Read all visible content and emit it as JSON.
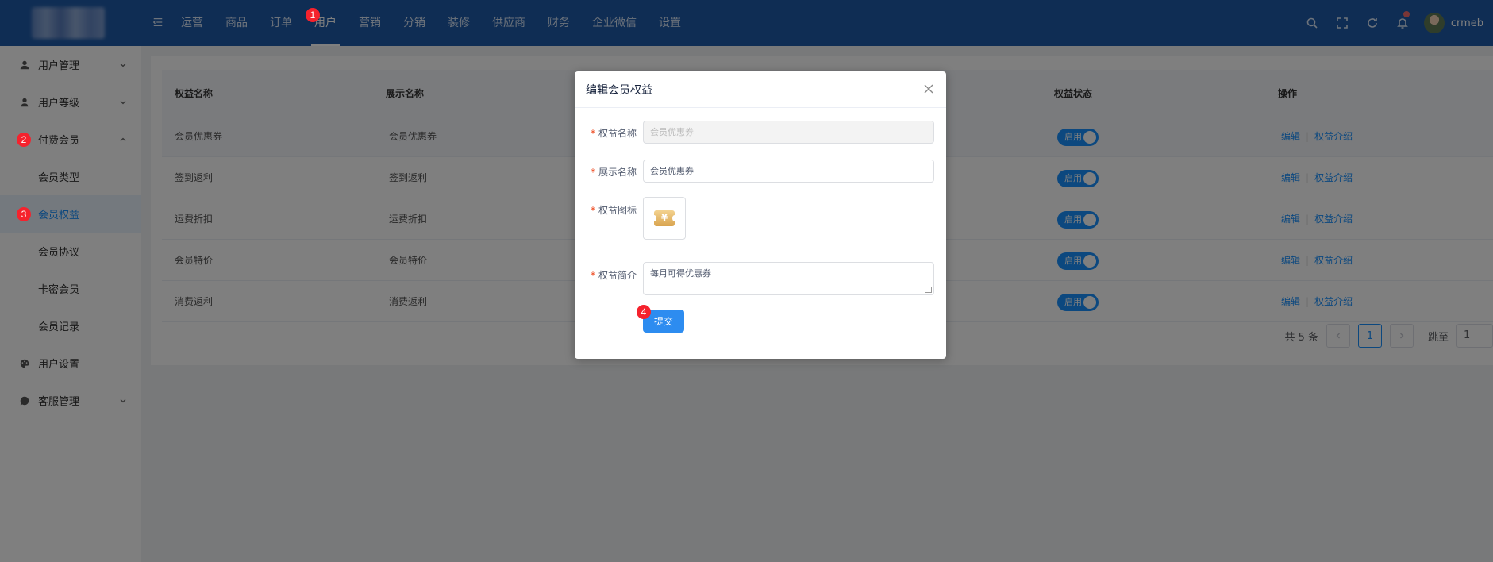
{
  "header": {
    "menu_toggle_icon": "menu-fold-icon",
    "nav": [
      "运营",
      "商品",
      "订单",
      "用户",
      "营销",
      "分销",
      "装修",
      "供应商",
      "财务",
      "企业微信",
      "设置"
    ],
    "active_nav": "用户",
    "username": "crmeb",
    "icons": [
      "search-icon",
      "fullscreen-icon",
      "refresh-icon",
      "bell-icon"
    ]
  },
  "steps": [
    "1",
    "2",
    "3",
    "4"
  ],
  "sidebar": {
    "items": [
      {
        "label": "用户管理",
        "icon": "user-icon",
        "chevron": "down"
      },
      {
        "label": "用户等级",
        "icon": "user-level-icon",
        "chevron": "down"
      },
      {
        "label": "付费会员",
        "icon": "vip-icon",
        "chevron": "up"
      },
      {
        "label": "会员类型"
      },
      {
        "label": "会员权益",
        "active": true
      },
      {
        "label": "会员协议"
      },
      {
        "label": "卡密会员"
      },
      {
        "label": "会员记录"
      },
      {
        "label": "用户设置",
        "icon": "palette-icon"
      },
      {
        "label": "客服管理",
        "icon": "chat-icon",
        "chevron": "down"
      }
    ]
  },
  "table": {
    "columns": [
      "权益名称",
      "展示名称",
      "权益状态",
      "操作"
    ],
    "rows": [
      {
        "name": "会员优惠券",
        "display": "会员优惠券",
        "status": "启用"
      },
      {
        "name": "签到返利",
        "display": "签到返利",
        "status": "启用"
      },
      {
        "name": "运费折扣",
        "display": "运费折扣",
        "status": "启用"
      },
      {
        "name": "会员特价",
        "display": "会员特价",
        "status": "启用"
      },
      {
        "name": "消费返利",
        "display": "消费返利",
        "status": "启用"
      }
    ],
    "actions": {
      "edit": "编辑",
      "intro": "权益介绍"
    }
  },
  "pagination": {
    "total": "共 5 条",
    "current_page": "1",
    "jump_label": "跳至",
    "jump_value": "1",
    "prev_icon": "chevron-left-icon",
    "next_icon": "chevron-right-icon"
  },
  "dialog": {
    "title": "编辑会员权益",
    "fields": {
      "name_label": "权益名称",
      "name_value": "会员优惠券",
      "display_label": "展示名称",
      "display_value": "会员优惠券",
      "icon_label": "权益图标",
      "icon_glyph": "¥",
      "intro_label": "权益简介",
      "intro_value": "每月可得优惠券"
    },
    "required_mark": "*",
    "submit": "提交"
  }
}
